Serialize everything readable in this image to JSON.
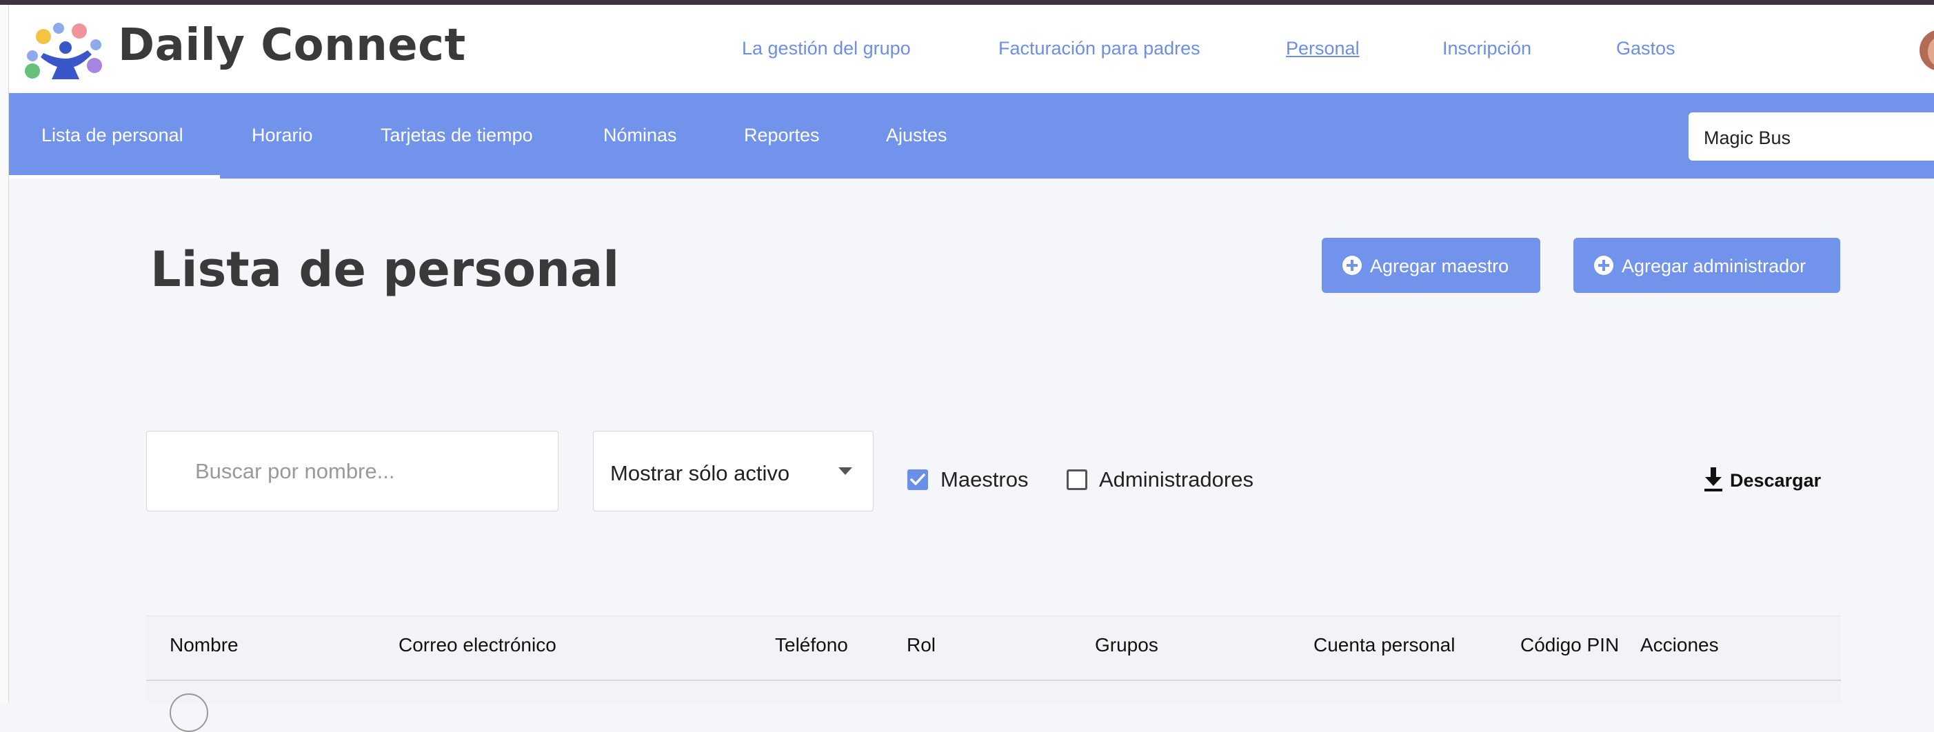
{
  "app": {
    "brand": "Daily Connect"
  },
  "top_nav": [
    {
      "label": "La gestión del grupo",
      "active": false
    },
    {
      "label": "Facturación para padres",
      "active": false
    },
    {
      "label": "Personal",
      "active": true
    },
    {
      "label": "Inscripción",
      "active": false
    },
    {
      "label": "Gastos",
      "active": false
    }
  ],
  "sub_nav": [
    {
      "label": "Lista de personal",
      "active": true
    },
    {
      "label": "Horario"
    },
    {
      "label": "Tarjetas de tiempo"
    },
    {
      "label": "Nóminas"
    },
    {
      "label": "Reportes"
    },
    {
      "label": "Ajustes"
    }
  ],
  "branch_select": {
    "value": "Magic Bus"
  },
  "page": {
    "title": "Lista de personal",
    "add_teacher": "Agregar maestro",
    "add_admin": "Agregar administrador"
  },
  "filters": {
    "search_placeholder": "Buscar por nombre...",
    "status_select": "Mostrar sólo activo",
    "teachers_label": "Maestros",
    "teachers_checked": true,
    "admins_label": "Administradores",
    "admins_checked": false,
    "download_label": "Descargar"
  },
  "table": {
    "headers": [
      "Nombre",
      "Correo electrónico",
      "Teléfono",
      "Rol",
      "Grupos",
      "Cuenta personal",
      "Código PIN",
      "Acciones"
    ]
  },
  "colors": {
    "accent": "#7193ec",
    "link": "#6b8ee6",
    "background": "#f5f6fa"
  },
  "icons": {
    "add": "plus-circle-icon",
    "download": "download-icon",
    "check": "check-icon",
    "dropdown": "chevron-down-icon"
  }
}
